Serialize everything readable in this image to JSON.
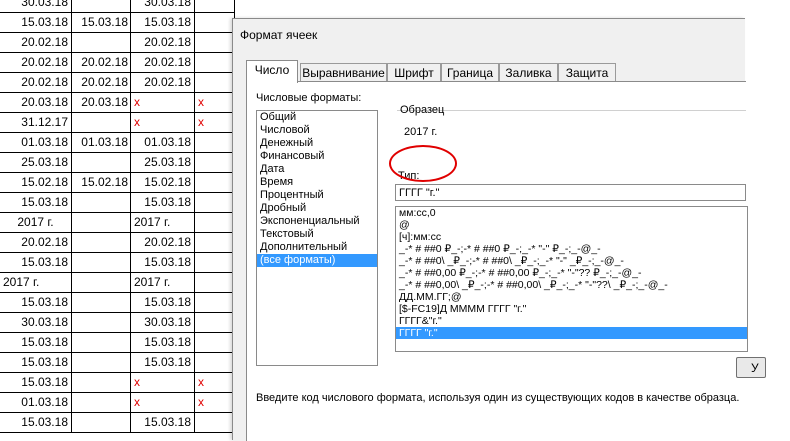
{
  "spreadsheet": {
    "rows": [
      [
        "30.03.18",
        "",
        "30.03.18",
        ""
      ],
      [
        "15.03.18",
        "15.03.18",
        "15.03.18",
        ""
      ],
      [
        "20.02.18",
        "",
        "20.02.18",
        ""
      ],
      [
        "20.02.18",
        "20.02.18",
        "20.02.18",
        ""
      ],
      [
        "20.02.18",
        "20.02.18",
        "20.02.18",
        ""
      ],
      [
        "20.03.18",
        "20.03.18",
        "x",
        "x"
      ],
      [
        "31.12.17",
        "",
        "x",
        "x"
      ],
      [
        "01.03.18",
        "01.03.18",
        "01.03.18",
        ""
      ],
      [
        "25.03.18",
        "",
        "25.03.18",
        ""
      ],
      [
        "15.02.18",
        "15.02.18",
        "15.02.18",
        ""
      ],
      [
        "15.03.18",
        "",
        "15.03.18",
        ""
      ],
      [
        "2017 г.",
        "",
        "2017 г.",
        ""
      ],
      [
        "20.02.18",
        "",
        "20.02.18",
        ""
      ],
      [
        "15.03.18",
        "",
        "15.03.18",
        ""
      ],
      [
        "2017 г.",
        "",
        "2017 г.",
        ""
      ],
      [
        "15.03.18",
        "",
        "15.03.18",
        ""
      ],
      [
        "30.03.18",
        "",
        "30.03.18",
        ""
      ],
      [
        "15.03.18",
        "",
        "15.03.18",
        ""
      ],
      [
        "15.03.18",
        "",
        "15.03.18",
        ""
      ],
      [
        "15.03.18",
        "",
        "x",
        "x"
      ],
      [
        "01.03.18",
        "",
        "x",
        "x"
      ],
      [
        "15.03.18",
        "",
        "15.03.18",
        ""
      ]
    ],
    "error_color": "#e00000"
  },
  "dialog": {
    "title": "Формат ячеек",
    "tabs": [
      "Число",
      "Выравнивание",
      "Шрифт",
      "Граница",
      "Заливка",
      "Защита"
    ],
    "active_tab": "Число",
    "categories_label": "Числовые форматы:",
    "categories": [
      "Общий",
      "Числовой",
      "Денежный",
      "Финансовый",
      "Дата",
      "Время",
      "Процентный",
      "Дробный",
      "Экспоненциальный",
      "Текстовый",
      "Дополнительный",
      "(все форматы)"
    ],
    "selected_category": "(все форматы)",
    "sample_label": "Образец",
    "sample_value": "2017 г.",
    "type_label": "Тип:",
    "type_value": "ГГГГ \"г.\"",
    "formats": [
      "мм:сс,0",
      "@",
      "[ч]:мм:сс",
      "_-* # ##0 ₽_-;-* # ##0 ₽_-;_-* \"-\" ₽_-;_-@_-",
      "_-* # ##0\\ _₽_-;-* # ##0\\ _₽_-;_-* \"-\" _₽_-;_-@_-",
      "_-* # ##0,00 ₽_-;-* # ##0,00 ₽_-;_-* \"-\"?? ₽_-;_-@_-",
      "_-* # ##0,00\\ _₽_-;-* # ##0,00\\ _₽_-;_-* \"-\"??\\ _₽_-;_-@_-",
      "ДД.ММ.ГГ;@",
      "[$-FC19]Д ММММ ГГГГ \"г.\"",
      "ГГГГ&\"г.\"",
      "ГГГГ \"г.\""
    ],
    "selected_format_index": 10,
    "delete_button": "У",
    "hint": "Введите код числового формата, используя один из существующих кодов в качестве образца.",
    "accent_color": "#3399ff",
    "annotation_color": "#e00000"
  }
}
